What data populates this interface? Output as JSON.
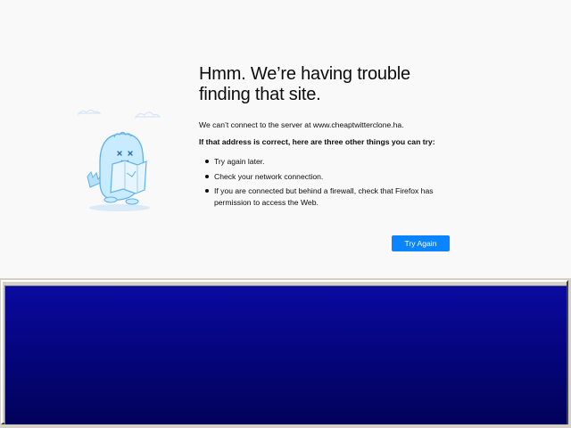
{
  "error_page": {
    "title": "Hmm. We’re having trouble finding that site.",
    "description": "We can’t connect to the server at www.cheaptwitterclone.ha.",
    "subheading": "If that address is correct, here are three other things you can try:",
    "suggestions": [
      "Try again later.",
      "Check your network connection.",
      "If you are connected but behind a firewall, check that Firefox has permission to access the Web."
    ],
    "try_again_label": "Try Again",
    "illustration_icon": "dinosaur-with-map-icon"
  },
  "colors": {
    "page_background": "#f9f9fa",
    "button_accent": "#0a84ff",
    "panel_blue": "#050580",
    "panel_frame": "#d4d0c8"
  }
}
